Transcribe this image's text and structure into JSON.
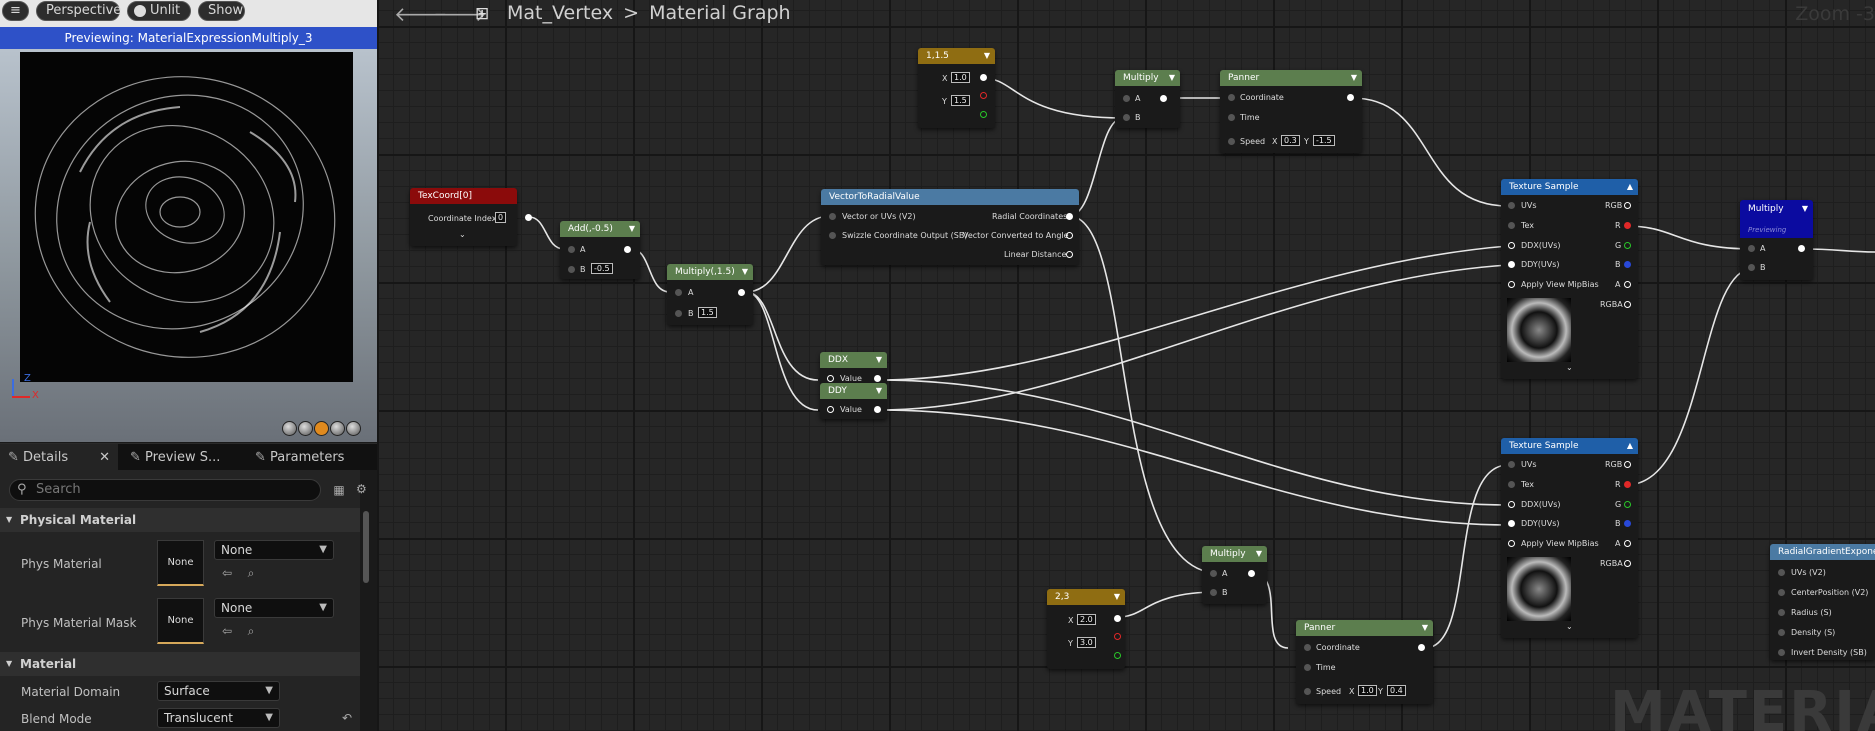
{
  "viewport": {
    "menu_icon": "hamburger-icon",
    "perspective": "Perspective",
    "lighting": "Unlit",
    "show": "Show",
    "previewing": "Previewing: MaterialExpressionMultiply_3",
    "axis_z": "Z",
    "axis_x": "X"
  },
  "tabs": {
    "details": "Details",
    "preview": "Preview S...",
    "parameters": "Parameters"
  },
  "details": {
    "search_placeholder": "Search",
    "physical_material": "Physical Material",
    "phys_material": "Phys Material",
    "phys_material_mask": "Phys Material Mask",
    "none_thumb": "None",
    "none_value": "None",
    "material": "Material",
    "material_domain": "Material Domain",
    "material_domain_value": "Surface",
    "blend_mode": "Blend Mode",
    "blend_mode_value": "Translucent"
  },
  "graph": {
    "asset": "Mat_Vertex",
    "sep": ">",
    "title": "Material Graph",
    "zoom": "Zoom -3",
    "watermark": "MATERIAL"
  },
  "nodes": {
    "texcoord": {
      "title": "TexCoord[0]",
      "pin": "Coordinate Index",
      "value": "0"
    },
    "add": {
      "title": "Add(,-0.5)",
      "a": "A",
      "b": "B",
      "b_value": "-0.5"
    },
    "mul1": {
      "title": "Multiply(,1.5)",
      "a": "A",
      "b": "B",
      "b_value": "1.5"
    },
    "c115": {
      "title": "1,1.5",
      "x": "X",
      "x_value": "1.0",
      "y": "Y",
      "y_value": "1.5"
    },
    "mul_top": {
      "title": "Multiply",
      "a": "A",
      "b": "B"
    },
    "panner_top": {
      "title": "Panner",
      "coord": "Coordinate",
      "time": "Time",
      "speed": "Speed",
      "sx": "X",
      "sx_value": "0.3",
      "sy": "Y",
      "sy_value": "-1.5"
    },
    "radial": {
      "title": "VectorToRadialValue",
      "in1": "Vector or UVs (V2)",
      "in2": "Swizzle Coordinate Output (SB)",
      "out1": "Radial Coordinates",
      "out2": "Vector Converted to Angle",
      "out3": "Linear Distance"
    },
    "ddx": {
      "title": "DDX",
      "pin": "Value"
    },
    "ddy": {
      "title": "DDY",
      "pin": "Value"
    },
    "tex1": {
      "title": "Texture Sample",
      "uvs": "UVs",
      "tex": "Tex",
      "ddx": "DDX(UVs)",
      "ddy": "DDY(UVs)",
      "mip": "Apply View MipBias",
      "rgb": "RGB",
      "r": "R",
      "g": "G",
      "b": "B",
      "a": "A",
      "rgba": "RGBA"
    },
    "tex2": {
      "title": "Texture Sample",
      "uvs": "UVs",
      "tex": "Tex",
      "ddx": "DDX(UVs)",
      "ddy": "DDY(UVs)",
      "mip": "Apply View MipBias",
      "rgb": "RGB",
      "r": "R",
      "g": "G",
      "b": "B",
      "a": "A",
      "rgba": "RGBA"
    },
    "mul_prev": {
      "title": "Multiply",
      "sub": "Previewing",
      "a": "A",
      "b": "B"
    },
    "mul_bottom": {
      "title": "Multiply",
      "a": "A",
      "b": "B"
    },
    "c23": {
      "title": "2,3",
      "x": "X",
      "x_value": "2.0",
      "y": "Y",
      "y_value": "3.0"
    },
    "panner_bottom": {
      "title": "Panner",
      "coord": "Coordinate",
      "time": "Time",
      "speed": "Speed",
      "sx": "X",
      "sx_value": "1.0",
      "sy": "Y",
      "sy_value": "0.4"
    },
    "radgrad": {
      "title": "RadialGradientExponential",
      "p1": "UVs (V2)",
      "p2": "CenterPosition (V2)",
      "p3": "Radius (S)",
      "p4": "Density (S)",
      "p5": "Invert Density (SB)"
    }
  },
  "colors": {
    "header_green": "#5c7e4e",
    "header_red": "#8b0b0b",
    "header_gold": "#8f6d12",
    "header_blue": "#4b7aa3",
    "header_tex": "#1f5fa8",
    "header_preview": "#0b0ba0",
    "preview_bar": "#2e51c8"
  }
}
